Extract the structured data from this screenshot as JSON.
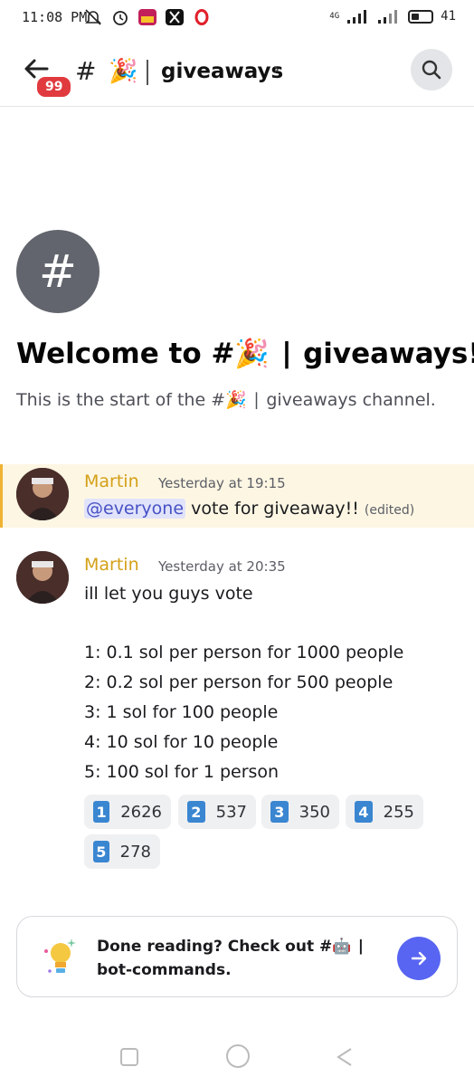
{
  "status_bar": {
    "time": "11:08 PM",
    "network": "4G",
    "battery": "41",
    "battery_fraction": 0.41
  },
  "header": {
    "badge_count": "99",
    "hash": "#",
    "channel_emoji": "🎉",
    "channel_name": "giveaways",
    "chevron": "›"
  },
  "welcome": {
    "avatar_hash": "#",
    "title": "Welcome to #🎉 ∣ giveaways!",
    "subtitle": "This is the start of the #🎉 ∣ giveaways channel."
  },
  "messages": [
    {
      "author": "Martin",
      "timestamp": "Yesterday at 19:15",
      "mention": "@everyone",
      "text": " vote for giveaway!! ",
      "edited": "(edited)"
    },
    {
      "author": "Martin",
      "timestamp": "Yesterday at 20:35",
      "lines": [
        "ill let you guys vote",
        "1: 0.1 sol per person for 1000 people",
        "2: 0.2 sol per person for 500 people",
        "3: 1 sol for 100 people",
        "4: 10 sol for 10 people",
        "5: 100 sol for 1 person"
      ],
      "reactions": [
        {
          "key": "1",
          "count": "2626"
        },
        {
          "key": "2",
          "count": "537"
        },
        {
          "key": "3",
          "count": "350"
        },
        {
          "key": "4",
          "count": "255"
        },
        {
          "key": "5",
          "count": "278"
        }
      ]
    }
  ],
  "next_channel": {
    "line1": "Done reading? Check out #🤖 ∣",
    "line2": "bot-commands."
  },
  "colors": {
    "accent": "#5865f2",
    "author": "#d4a018",
    "badge": "#e03a3e",
    "highlight_bg": "#fdf6e3",
    "highlight_bar": "#f0b232",
    "keycap": "#3a86d1"
  }
}
